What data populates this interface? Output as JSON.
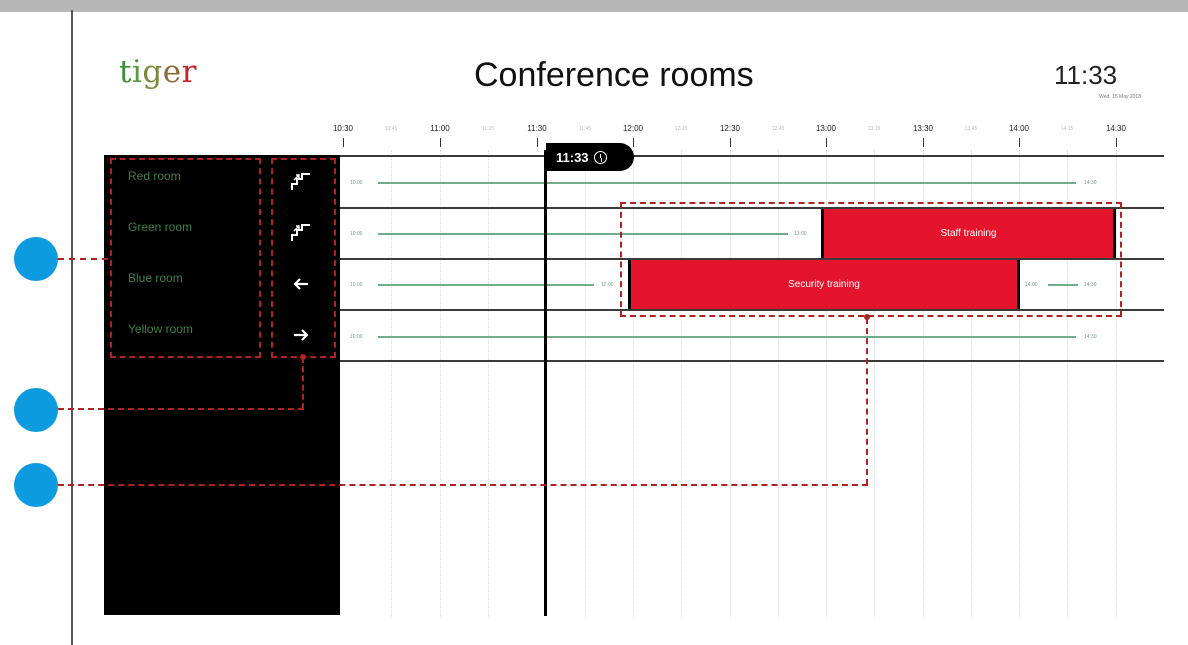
{
  "header": {
    "logo_letters": [
      {
        "char": "t",
        "color": "#3a8f3a"
      },
      {
        "char": "i",
        "color": "#5a9a3a"
      },
      {
        "char": "g",
        "color": "#7a8a3a"
      },
      {
        "char": "e",
        "color": "#8a6a3a"
      },
      {
        "char": "r",
        "color": "#c02626"
      }
    ],
    "title": "Conference rooms",
    "time": "11:33",
    "date": "Wed. 15 May 2018"
  },
  "timeline": {
    "major": [
      "10:30",
      "11:00",
      "11:30",
      "12:00",
      "12:30",
      "13:00",
      "13:30",
      "14:00",
      "14:30"
    ],
    "minor": [
      "10:45",
      "11:15",
      "11:45",
      "12:15",
      "12:45",
      "13:15",
      "13:45",
      "14:15"
    ],
    "now_label": "11:33"
  },
  "rooms": [
    {
      "name": "Red room",
      "icon": "stairs-up-icon",
      "segments": [
        {
          "from": "10:30",
          "to": "14:30",
          "label_start": "10:00",
          "label_end": "14:30"
        }
      ],
      "bookings": []
    },
    {
      "name": "Green room",
      "icon": "stairs-up-icon",
      "segments": [
        {
          "from": "10:30",
          "to": "13:00",
          "label_start": "10:00",
          "label_end": "13:00"
        }
      ],
      "bookings": [
        {
          "title": "Staff training",
          "from": "13:00",
          "to": "14:30"
        }
      ]
    },
    {
      "name": "Blue room",
      "icon": "arrow-left-icon",
      "segments": [
        {
          "from": "10:30",
          "to": "12:00",
          "label_start": "10:00",
          "label_end": "12:00"
        },
        {
          "from": "14:00",
          "to": "14:30",
          "label_start": "14:00",
          "label_end": "14:30"
        }
      ],
      "bookings": [
        {
          "title": "Security training",
          "from": "12:00",
          "to": "14:00"
        }
      ]
    },
    {
      "name": "Yellow room",
      "icon": "arrow-right-icon",
      "segments": [
        {
          "from": "10:30",
          "to": "14:30",
          "label_start": "10:00",
          "label_end": "14:30"
        }
      ],
      "bookings": []
    }
  ],
  "colors": {
    "booking": "#e4142d",
    "available_line": "#6fae8c",
    "room_text": "#3d7f49",
    "annotation": "#b02121",
    "marker": "#0d9be0"
  }
}
